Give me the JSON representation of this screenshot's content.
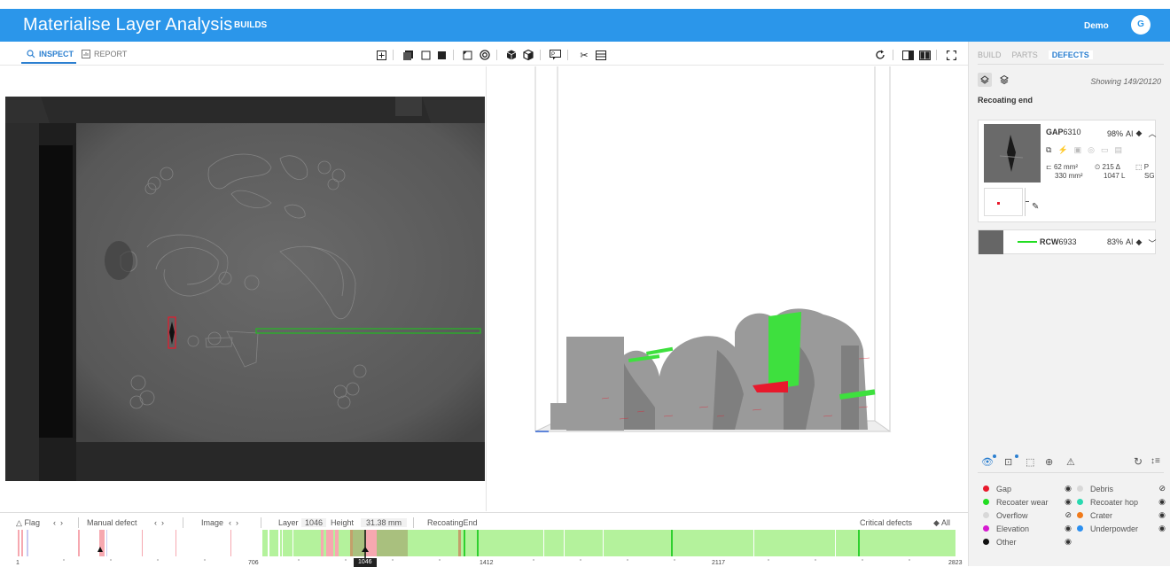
{
  "app": {
    "title": "Materialise Layer Analysis",
    "nav_builds": "BUILDS",
    "user": "Demo",
    "avatar_initial": "G"
  },
  "toolbar": {
    "inspect_label": "INSPECT",
    "report_label": "REPORT"
  },
  "right_panel": {
    "tabs": [
      "BUILD",
      "PARTS",
      "DEFECTS"
    ],
    "active_tab": "DEFECTS",
    "showing": "Showing 149/20120",
    "section": "Recoating end",
    "defects": [
      {
        "code": "GAP",
        "id": "6310",
        "confidence": "98%",
        "source": "AI",
        "area1": "62 mm²",
        "area2": "330 mm²",
        "layers1": "215 Δ",
        "layers2": "1047 L",
        "tag1": "P",
        "tag2": "SG"
      },
      {
        "code": "RCW",
        "id": "6933",
        "confidence": "83%",
        "source": "AI"
      }
    ],
    "legend": [
      {
        "label": "Gap",
        "color": "#e8192c",
        "state": "visible"
      },
      {
        "label": "Debris",
        "color": "#d8d8d8",
        "state": "hidden"
      },
      {
        "label": "Recoater wear",
        "color": "#22dd22",
        "state": "visible"
      },
      {
        "label": "Recoater hop",
        "color": "#29d9b0",
        "state": "visible"
      },
      {
        "label": "Overflow",
        "color": "#d8d8d8",
        "state": "hidden"
      },
      {
        "label": "Crater",
        "color": "#f07a1a",
        "state": "visible"
      },
      {
        "label": "Elevation",
        "color": "#d61ad0",
        "state": "visible"
      },
      {
        "label": "Underpowder",
        "color": "#2b8ff0",
        "state": "visible"
      },
      {
        "label": "Other",
        "color": "#111111",
        "state": "visible"
      }
    ]
  },
  "bottom": {
    "flag": "Flag",
    "manual_defect": "Manual defect",
    "image": "Image",
    "layer_label": "Layer",
    "layer_value": "1046",
    "height_label": "Height",
    "height_value": "31.38 mm",
    "recoating": "RecoatingEnd",
    "critical": "Critical defects",
    "all": "All",
    "ticks": [
      "1",
      "706",
      "1046",
      "1412",
      "2117",
      "2823"
    ]
  }
}
